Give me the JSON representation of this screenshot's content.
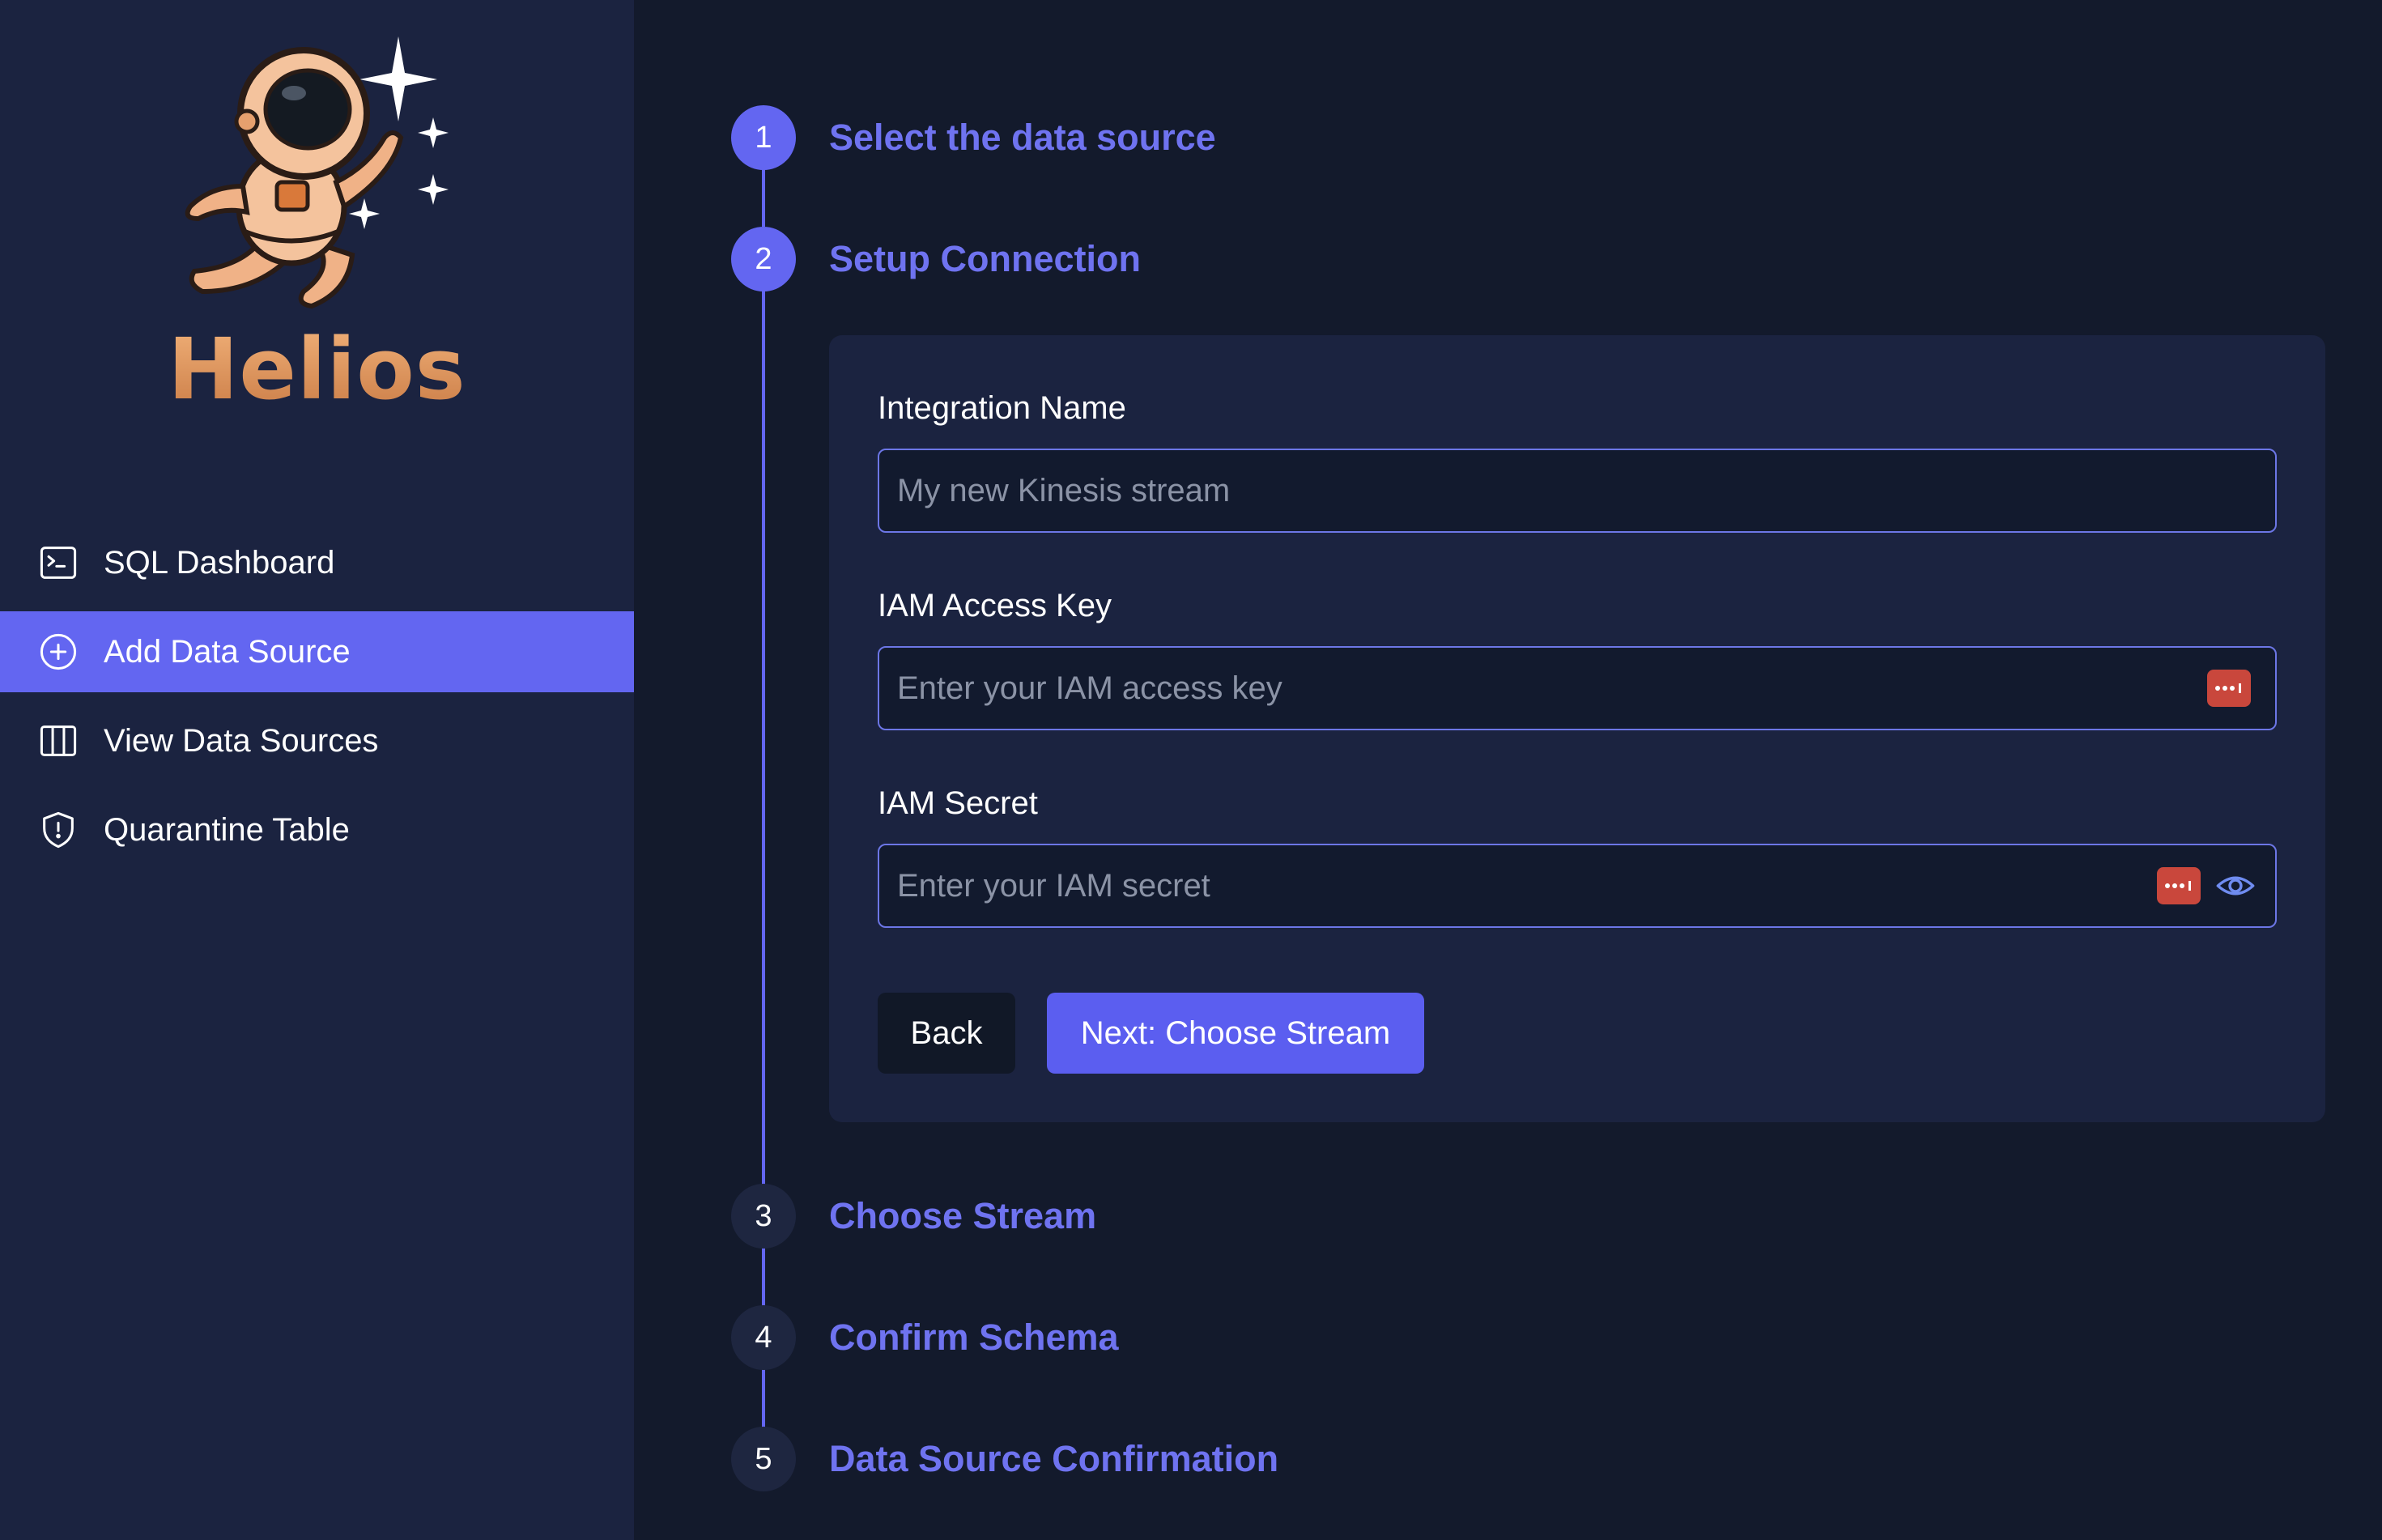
{
  "app": {
    "name": "Helios"
  },
  "sidebar": {
    "items": [
      {
        "label": "SQL Dashboard",
        "icon": "terminal-icon",
        "active": false
      },
      {
        "label": "Add Data Source",
        "icon": "plus-circle-icon",
        "active": true
      },
      {
        "label": "View Data Sources",
        "icon": "columns-icon",
        "active": false
      },
      {
        "label": "Quarantine Table",
        "icon": "shield-alert-icon",
        "active": false
      }
    ]
  },
  "steps": [
    {
      "number": "1",
      "title": "Select the data source",
      "state": "complete"
    },
    {
      "number": "2",
      "title": "Setup Connection",
      "state": "current"
    },
    {
      "number": "3",
      "title": "Choose Stream",
      "state": "pending"
    },
    {
      "number": "4",
      "title": "Confirm Schema",
      "state": "pending"
    },
    {
      "number": "5",
      "title": "Data Source Confirmation",
      "state": "pending"
    }
  ],
  "form": {
    "integration_name": {
      "label": "Integration Name",
      "value": "",
      "placeholder": "My new Kinesis stream"
    },
    "access_key": {
      "label": "IAM Access Key",
      "value": "",
      "placeholder": "Enter your IAM access key"
    },
    "secret": {
      "label": "IAM Secret",
      "value": "",
      "placeholder": "Enter your IAM secret"
    },
    "back_label": "Back",
    "next_label": "Next: Choose Stream"
  },
  "colors": {
    "accent": "#6366f1",
    "background": "#131a2c",
    "sidebar": "#1b2340",
    "password_manager": "#c9473c"
  }
}
